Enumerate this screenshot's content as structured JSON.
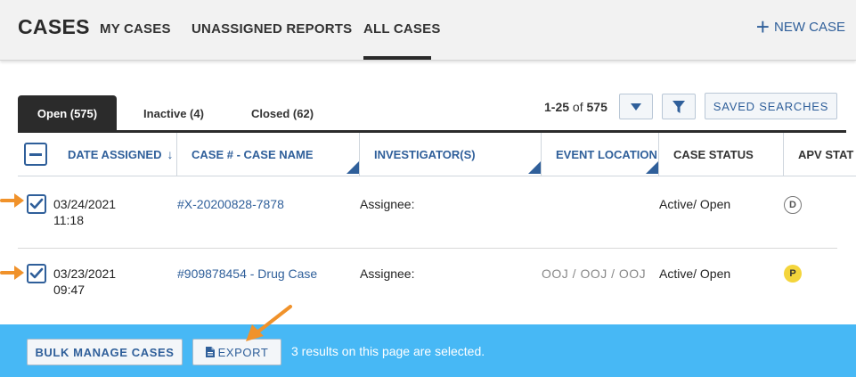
{
  "header": {
    "brand": "CASES",
    "nav": [
      "MY CASES",
      "UNASSIGNED REPORTS",
      "ALL CASES"
    ],
    "active_nav": "ALL CASES",
    "new_case_label": "NEW CASE"
  },
  "tabs": [
    {
      "label": "Open (575)",
      "active": true
    },
    {
      "label": "Inactive (4)",
      "active": false
    },
    {
      "label": "Closed (62)",
      "active": false
    }
  ],
  "pager": {
    "range": "1-25",
    "of_label": "of",
    "total": "575"
  },
  "toolbar": {
    "saved_searches_label": "SAVED SEARCHES"
  },
  "columns": [
    {
      "label": "DATE ASSIGNED",
      "sortable": true,
      "sort_glyph": "↓"
    },
    {
      "label": "CASE # - CASE NAME",
      "sortable": true
    },
    {
      "label": "INVESTIGATOR(S)",
      "sortable": true
    },
    {
      "label": "EVENT LOCATION",
      "sortable": true
    },
    {
      "label": "CASE STATUS",
      "sortable": false
    },
    {
      "label": "APV STAT",
      "sortable": false
    }
  ],
  "rows": [
    {
      "date": "03/24/2021",
      "time": "11:18",
      "case": "#X-20200828-7878",
      "investigator": "Assignee:",
      "location": "",
      "status": "Active/ Open",
      "apv": "D",
      "checked": true
    },
    {
      "date": "03/23/2021",
      "time": "09:47",
      "case": "#909878454 - Drug Case",
      "investigator": "Assignee:",
      "location": "OOJ / OOJ / OOJ",
      "status": "Active/ Open",
      "apv": "P",
      "checked": true
    }
  ],
  "bottom": {
    "bulk_label": "BULK MANAGE CASES",
    "export_label": "EXPORT",
    "selected_text": "3 results on this page are selected."
  },
  "colors": {
    "accent_blue": "#2f5f9a",
    "bar_blue": "#47b8f5",
    "arrow_orange": "#f0922b",
    "badge_yellow": "#f4d53c"
  }
}
